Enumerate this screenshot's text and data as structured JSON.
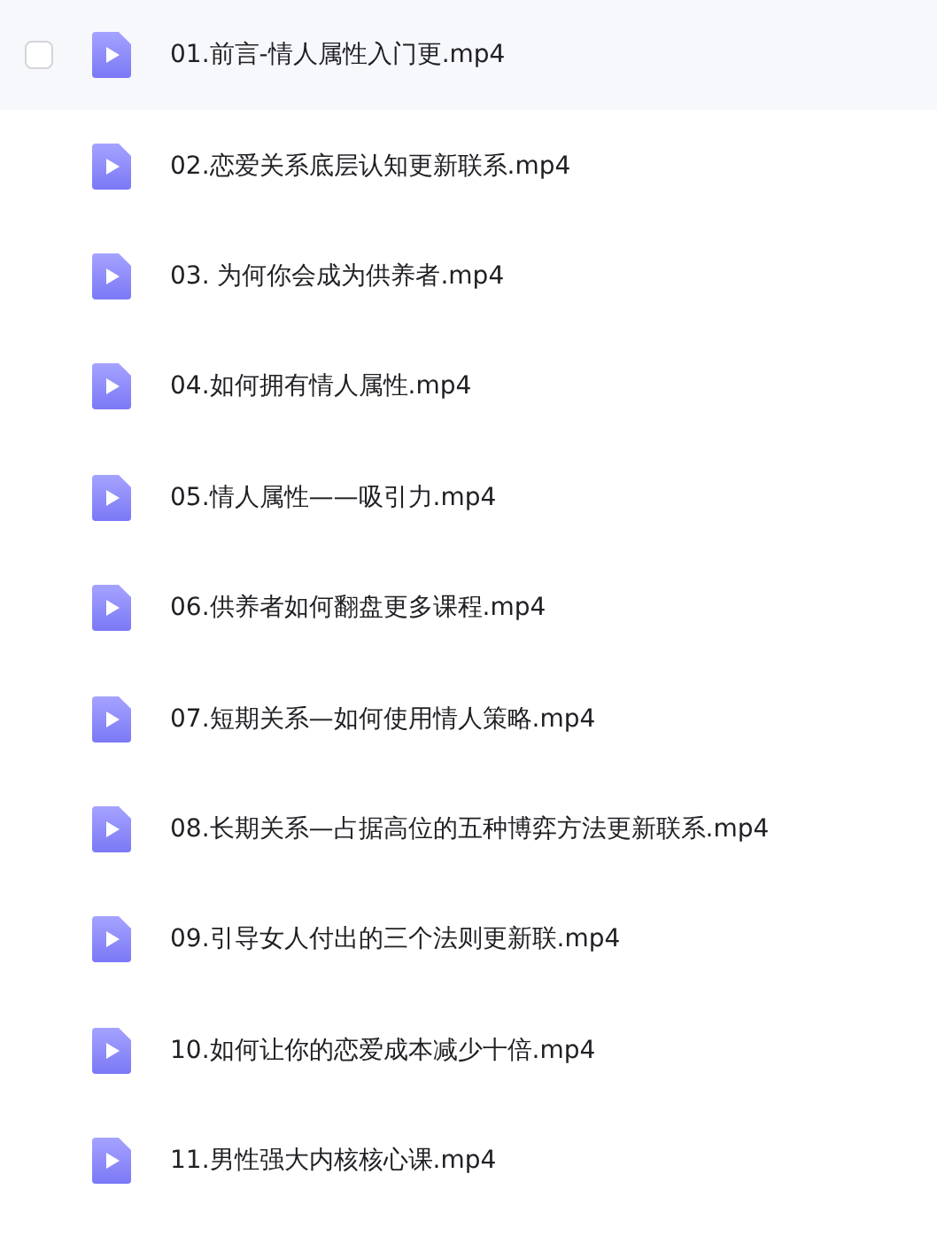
{
  "files": [
    {
      "name": "01.前言-情人属性入门更.mp4",
      "hovered": true,
      "checked": false
    },
    {
      "name": "02.恋爱关系底层认知更新联系.mp4",
      "hovered": false,
      "checked": false
    },
    {
      "name": "03. 为何你会成为供养者.mp4",
      "hovered": false,
      "checked": false
    },
    {
      "name": "04.如何拥有情人属性.mp4",
      "hovered": false,
      "checked": false
    },
    {
      "name": "05.情人属性——吸引力.mp4",
      "hovered": false,
      "checked": false
    },
    {
      "name": "06.供养者如何翻盘更多课程.mp4",
      "hovered": false,
      "checked": false
    },
    {
      "name": "07.短期关系—如何使用情人策略.mp4",
      "hovered": false,
      "checked": false
    },
    {
      "name": "08.长期关系—占据高位的五种博弈方法更新联系.mp4",
      "hovered": false,
      "checked": false
    },
    {
      "name": "09.引导女人付出的三个法则更新联.mp4",
      "hovered": false,
      "checked": false
    },
    {
      "name": "10.如何让你的恋爱成本减少十倍.mp4",
      "hovered": false,
      "checked": false
    },
    {
      "name": "11.男性强大内核核心课.mp4",
      "hovered": false,
      "checked": false
    }
  ]
}
